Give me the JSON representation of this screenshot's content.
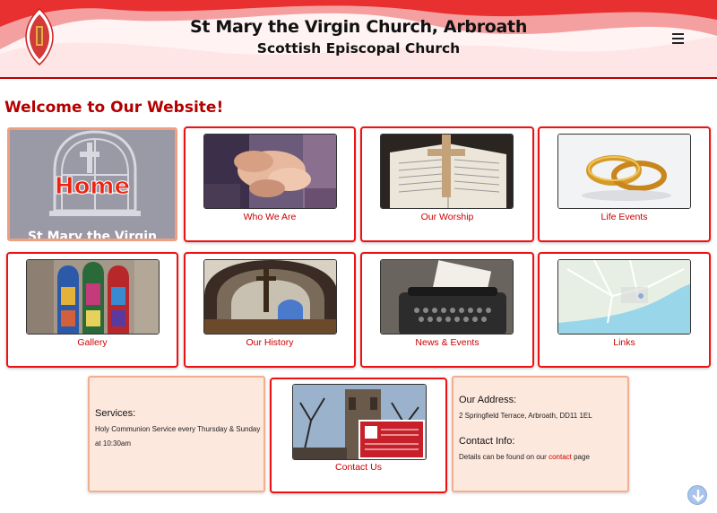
{
  "header": {
    "title": "St Mary the Virgin Church, Arbroath",
    "subtitle": "Scottish Episcopal Church",
    "menu_icon": "hamburger-menu-icon",
    "crest_icon": "church-crest-icon"
  },
  "welcome": "Welcome to Our Website!",
  "home_tile": {
    "label": "Home",
    "subtitle": "St Mary the Virgin"
  },
  "tiles": [
    {
      "label": "Who We Are",
      "image": "hands-together-photo"
    },
    {
      "label": "Our Worship",
      "image": "open-bible-cross-photo"
    },
    {
      "label": "Life Events",
      "image": "wedding-rings-photo"
    },
    {
      "label": "Gallery",
      "image": "stained-glass-window-photo"
    },
    {
      "label": "Our History",
      "image": "church-interior-arch-photo"
    },
    {
      "label": "News & Events",
      "image": "typewriter-news-photo"
    },
    {
      "label": "Links",
      "image": "map-photo"
    },
    {
      "label": "Contact Us",
      "image": "church-exterior-sign-photo"
    }
  ],
  "services": {
    "heading": "Services:",
    "text_line1": "Holy Communion Service every Thursday & Sunday",
    "text_line2": "at 10:30am"
  },
  "address": {
    "heading": "Our Address:",
    "text": "2 Springfield Terrace, Arbroath,  DD11 1EL",
    "contact_heading": "Contact Info:",
    "contact_prefix": "Details can be found on our",
    "contact_link": "contact",
    "contact_suffix": "page"
  },
  "scroll_icon": "scroll-down-arrow-icon",
  "colors": {
    "accent": "#cc0000",
    "info_bg": "#fde8de"
  }
}
